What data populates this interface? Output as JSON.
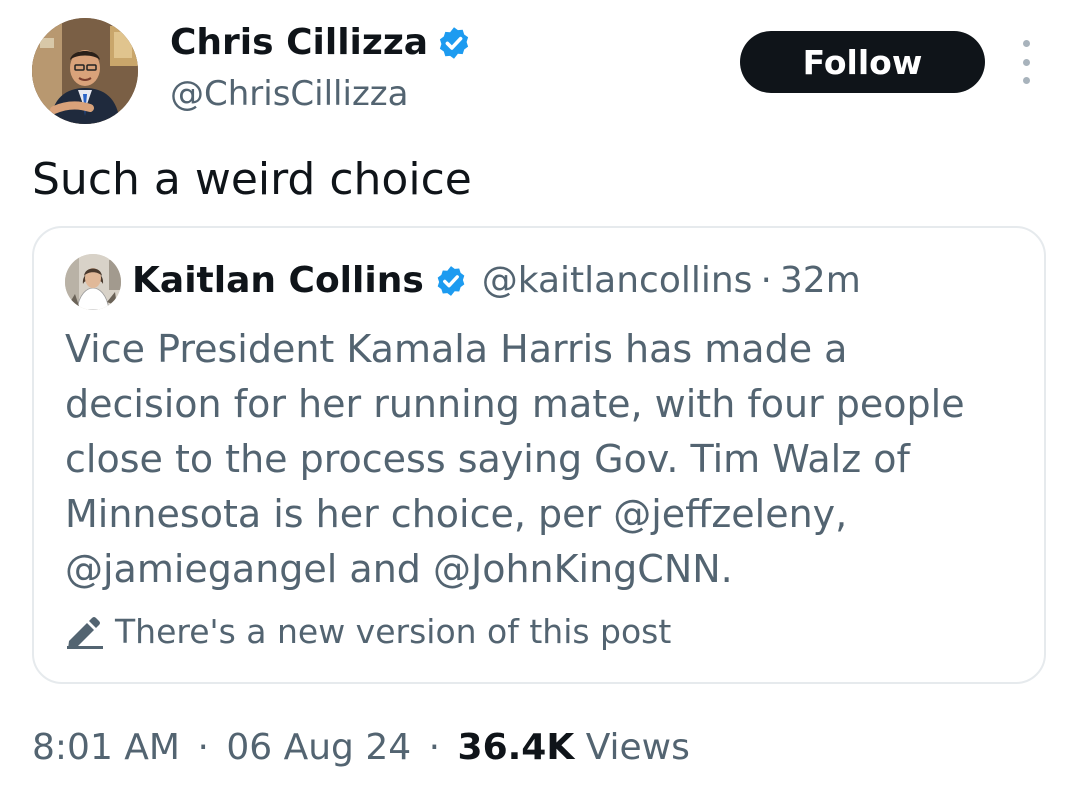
{
  "author": {
    "name": "Chris Cillizza",
    "handle": "@ChrisCillizza",
    "verified": true
  },
  "follow_label": "Follow",
  "tweet_text": "Such a weird choice",
  "quoted": {
    "name": "Kaitlan Collins",
    "handle": "@kaitlancollins",
    "separator": "·",
    "age": "32m",
    "verified": true,
    "text_lines": [
      "Vice President Kamala Harris has made a",
      "decision for her running mate, with four people",
      "close to the process saying Gov. Tim Walz of",
      "Minnesota is her choice, per @jeffzeleny,",
      "@jamiegangel and @JohnKingCNN."
    ],
    "edit_notice": "There's a new version of this post"
  },
  "meta": {
    "time": "8:01 AM",
    "separator": "·",
    "date": "06 Aug 24",
    "views_count": "36.4K",
    "views_label": "Views"
  },
  "colors": {
    "verified_blue": "#1d9bf0",
    "text_primary": "#0f1419",
    "text_secondary": "#536471",
    "border": "#e6eaed"
  },
  "icons": [
    "verified-badge-icon",
    "more-options-icon",
    "edit-pencil-icon"
  ]
}
